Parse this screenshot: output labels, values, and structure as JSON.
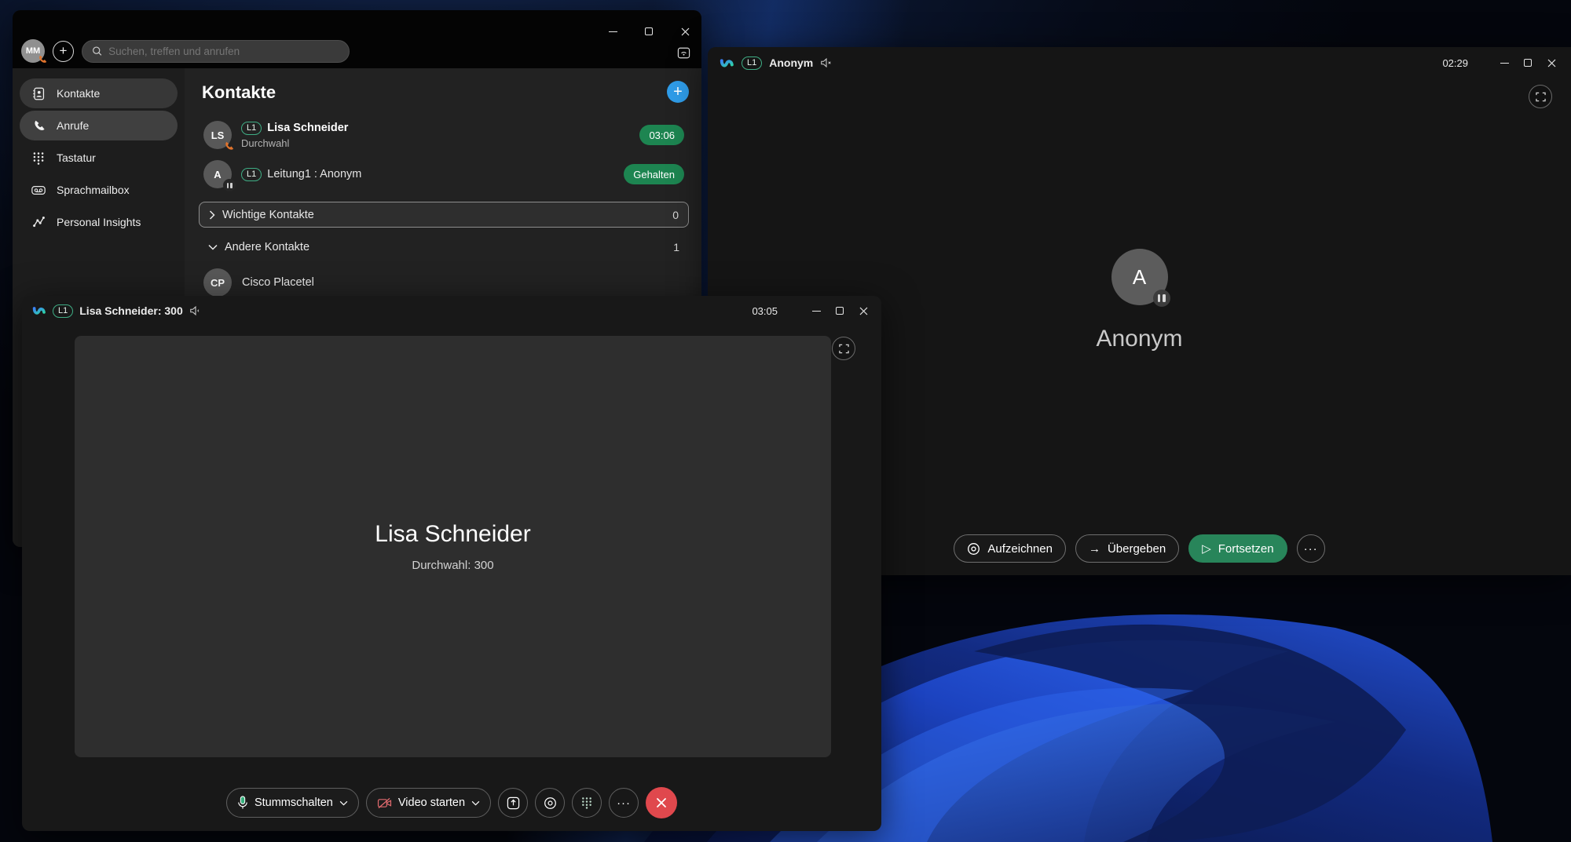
{
  "desktop": {
    "wallpaper": "windows-11-blue-bloom"
  },
  "icons": {
    "plus": "+",
    "arrow_right": "→",
    "play": "▷",
    "more": "···"
  },
  "colors": {
    "badge_green": "#1d8551",
    "primary_green": "#28855a",
    "accent_blue": "#2f9ce8",
    "danger_red": "#e0484d",
    "line_badge_green": "#3fae85"
  },
  "main_window": {
    "topbar": {
      "avatar_initials": "MM",
      "search_placeholder": "Suchen, treffen und anrufen"
    },
    "sidebar": {
      "items": [
        {
          "label": "Kontakte"
        },
        {
          "label": "Anrufe"
        },
        {
          "label": "Tastatur"
        },
        {
          "label": "Sprachmailbox"
        },
        {
          "label": "Personal Insights"
        }
      ]
    },
    "content": {
      "title": "Kontakte",
      "calls": [
        {
          "initials": "LS",
          "line_badge": "L1",
          "name": "Lisa Schneider",
          "sub": "Durchwahl",
          "status": "03:06"
        },
        {
          "initials": "A",
          "line_badge": "L1",
          "name": "Leitung1 : Anonym",
          "status": "Gehalten"
        }
      ],
      "groups": [
        {
          "label": "Wichtige Kontakte",
          "count": "0"
        },
        {
          "label": "Andere Kontakte",
          "count": "1"
        }
      ],
      "contacts": [
        {
          "initials": "CP",
          "name": "Cisco Placetel"
        }
      ]
    }
  },
  "anonym_window": {
    "titlebar": {
      "line_badge": "L1",
      "title": "Anonym",
      "timer": "02:29"
    },
    "participant": {
      "initial": "A",
      "name": "Anonym"
    },
    "actions": [
      {
        "label": "Aufzeichnen"
      },
      {
        "label": "Übergeben"
      },
      {
        "label": "Fortsetzen"
      }
    ]
  },
  "call_window": {
    "titlebar": {
      "line_badge": "L1",
      "title": "Lisa Schneider: 300",
      "timer": "03:05"
    },
    "stage": {
      "name": "Lisa Schneider",
      "sub": "Durchwahl: 300"
    },
    "controls": {
      "mute_label": "Stummschalten",
      "video_label": "Video starten"
    }
  }
}
